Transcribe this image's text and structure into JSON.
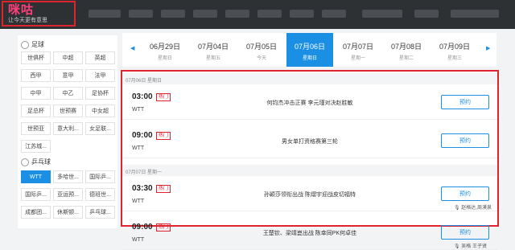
{
  "logo": {
    "main": "咪咕",
    "sub": "让今天更有意思"
  },
  "sidebar": {
    "categories": [
      {
        "title": "足球",
        "items": [
          "世俱杯",
          "中超",
          "英超",
          "西甲",
          "意甲",
          "法甲",
          "中甲",
          "中乙",
          "足协杯",
          "足总杯",
          "世预赛",
          "中女超",
          "世预亚",
          "意大利...",
          "女足联...",
          "江苏城..."
        ]
      },
      {
        "title": "乒乓球",
        "items": [
          "WTT",
          "多哈世...",
          "国际乒...",
          "国际乒...",
          "亚运预...",
          "德班世...",
          "成都团...",
          "休斯顿...",
          "乒乓球..."
        ]
      }
    ]
  },
  "datebar": {
    "prev_icon": "chevron-left-icon",
    "next_icon": "chevron-right-icon",
    "dates": [
      {
        "date": "06月29日",
        "weekday": "星期日"
      },
      {
        "date": "07月04日",
        "weekday": "星期五"
      },
      {
        "date": "07月05日",
        "weekday": "今天"
      },
      {
        "date": "07月06日",
        "weekday": "星期日",
        "active": true
      },
      {
        "date": "07月07日",
        "weekday": "星期一"
      },
      {
        "date": "07月08日",
        "weekday": "星期二"
      },
      {
        "date": "07月09日",
        "weekday": "星期三"
      }
    ]
  },
  "schedule": {
    "days": [
      {
        "header": "07月06日 星期日",
        "matches": [
          {
            "time": "03:00",
            "hot": "热门",
            "league": "WTT",
            "title": "何钧杰冲击正赛 李元瑾对决赵胜敏",
            "button": "预约",
            "note": ""
          },
          {
            "time": "09:00",
            "hot": "热门",
            "league": "WTT",
            "title": "男女单打资格赛第三轮",
            "button": "预约",
            "note": ""
          }
        ]
      },
      {
        "header": "07月07日 星期一",
        "matches": [
          {
            "time": "03:30",
            "hot": "热门",
            "league": "WTT",
            "title": "孙颖莎领衔出战 陈熠宇迎战皮切福特",
            "button": "预约",
            "note": "赵格达,周漠泉"
          },
          {
            "time": "09:00",
            "hot": "热门",
            "league": "WTT",
            "title": "王楚钦、梁靖崑出战 陈幸同PK何卓佳",
            "button": "预约",
            "note": "吴格 王子贤"
          }
        ]
      }
    ]
  },
  "colors": {
    "accent": "#1a8fe3",
    "hot": "#e0242f",
    "highlight": "#e0242f"
  }
}
